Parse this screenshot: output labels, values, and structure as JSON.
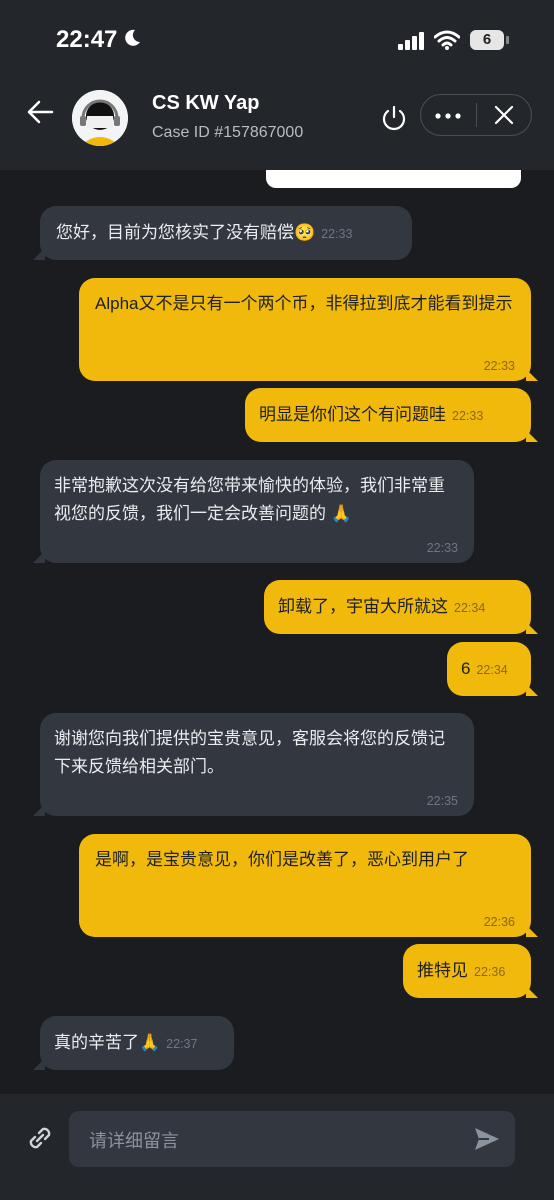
{
  "status_bar": {
    "time": "22:47",
    "battery": "6"
  },
  "header": {
    "agent_name": "CS KW Yap",
    "case_id": "Case ID #157867000"
  },
  "messages": [
    {
      "side": "in",
      "text": "您好，目前为您核实了没有赔偿🥺",
      "time": "22:33"
    },
    {
      "side": "out",
      "text": "Alpha又不是只有一个两个币，非得拉到底才能看到提示",
      "time": "22:33"
    },
    {
      "side": "out",
      "text": "明显是你们这个有问题哇",
      "time": "22:33"
    },
    {
      "side": "in",
      "text": "非常抱歉这次没有给您带来愉快的体验，我们非常重视您的反馈，我们一定会改善问题的 🙏",
      "time": "22:33"
    },
    {
      "side": "out",
      "text": "卸载了，宇宙大所就这",
      "time": "22:34"
    },
    {
      "side": "out",
      "text": "6",
      "time": "22:34"
    },
    {
      "side": "in",
      "text": "谢谢您向我们提供的宝贵意见，客服会将您的反馈记下来反馈给相关部门。",
      "time": "22:35"
    },
    {
      "side": "out",
      "text": "是啊，是宝贵意见，你们是改善了，恶心到用户了",
      "time": "22:36"
    },
    {
      "side": "out",
      "text": "推特见",
      "time": "22:36"
    },
    {
      "side": "in",
      "text": "真的辛苦了🙏",
      "time": "22:37"
    }
  ],
  "composer": {
    "placeholder": "请详细留言"
  },
  "icons": {
    "back": "arrow-left-icon",
    "power": "power-icon",
    "more": "more-horizontal-icon",
    "close": "close-icon",
    "attach": "link-icon",
    "send": "send-icon"
  },
  "colors": {
    "accent": "#f0b90b",
    "incoming_bubble": "#33373f",
    "background": "#1b1c20",
    "header": "#23262b"
  }
}
